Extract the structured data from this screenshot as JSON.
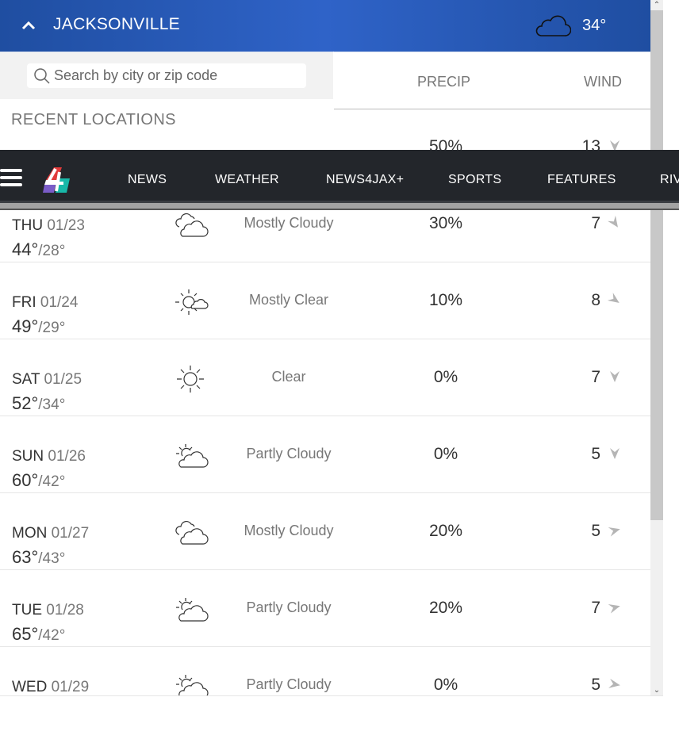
{
  "header": {
    "city": "JACKSONVILLE",
    "current_temp": "34°",
    "current_icon": "cloud-icon"
  },
  "search": {
    "placeholder": "Search by city or zip code",
    "value": ""
  },
  "recent_locations_label": "RECENT LOCATIONS",
  "columns": {
    "precip": "PRECIP",
    "wind": "WIND"
  },
  "nav": {
    "items": [
      "NEWS",
      "WEATHER",
      "NEWS4JAX+",
      "SPORTS",
      "FEATURES",
      "RIV"
    ]
  },
  "forecast": [
    {
      "dow": "",
      "date": "",
      "high": "",
      "low": "",
      "icon": "",
      "condition": "",
      "precip": "50%",
      "wind": "13",
      "wind_arrow_deg": 180
    },
    {
      "dow": "THU",
      "date": "01/23",
      "high": "44°",
      "low": "/28°",
      "icon": "mostly-cloudy",
      "condition": "Mostly Cloudy",
      "precip": "30%",
      "wind": "7",
      "wind_arrow_deg": 145
    },
    {
      "dow": "FRI",
      "date": "01/24",
      "high": "49°",
      "low": "/29°",
      "icon": "mostly-clear",
      "condition": "Mostly Clear",
      "precip": "10%",
      "wind": "8",
      "wind_arrow_deg": 125
    },
    {
      "dow": "SAT",
      "date": "01/25",
      "high": "52°",
      "low": "/34°",
      "icon": "clear",
      "condition": "Clear",
      "precip": "0%",
      "wind": "7",
      "wind_arrow_deg": 180
    },
    {
      "dow": "SUN",
      "date": "01/26",
      "high": "60°",
      "low": "/42°",
      "icon": "partly-cloudy",
      "condition": "Partly Cloudy",
      "precip": "0%",
      "wind": "5",
      "wind_arrow_deg": 180
    },
    {
      "dow": "MON",
      "date": "01/27",
      "high": "63°",
      "low": "/43°",
      "icon": "mostly-cloudy",
      "condition": "Mostly Cloudy",
      "precip": "20%",
      "wind": "5",
      "wind_arrow_deg": 75
    },
    {
      "dow": "TUE",
      "date": "01/28",
      "high": "65°",
      "low": "/42°",
      "icon": "partly-cloudy",
      "condition": "Partly Cloudy",
      "precip": "20%",
      "wind": "7",
      "wind_arrow_deg": 75
    },
    {
      "dow": "WED",
      "date": "01/29",
      "high": "",
      "low": "",
      "icon": "partly-cloudy",
      "condition": "Partly Cloudy",
      "precip": "0%",
      "wind": "5",
      "wind_arrow_deg": 100
    }
  ],
  "colors": {
    "header_blue": "#2f63c8",
    "nav_dark": "#23262b"
  }
}
